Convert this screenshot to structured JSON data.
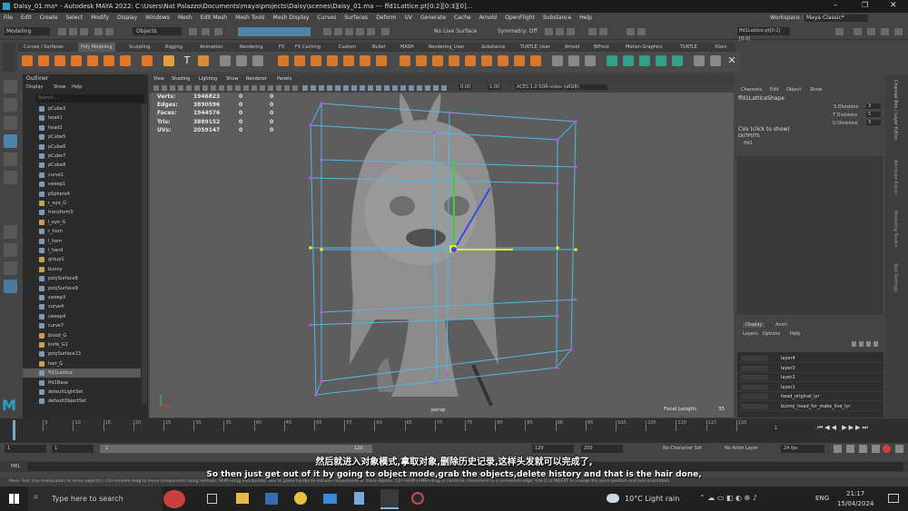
{
  "window": {
    "title": "Daisy_01.ma* - Autodesk MAYA 2022: C:\\Users\\Nat Palazzo\\Documents\\maya\\projects\\Daisy\\scenes\\Daisy_01.ma    ---    ffd1Lattice.pt[0:2][0:3][0]...",
    "workspace_label": "Workspace :",
    "workspace_value": "Maya Classic*"
  },
  "menu": [
    "File",
    "Edit",
    "Create",
    "Select",
    "Modify",
    "Display",
    "Windows",
    "Mesh",
    "Edit Mesh",
    "Mesh Tools",
    "Mesh Display",
    "Curves",
    "Surfaces",
    "Deform",
    "UV",
    "Generate",
    "Cache",
    "Arnold",
    "OpenFlight",
    "Substance",
    "Help"
  ],
  "toolbar": {
    "mode": "Modeling",
    "objects": "Objects",
    "live_surface": "No Live Surface",
    "symmetry": "Symmetry: Off",
    "selection_field": "ffd1Lattice.pt[0:2][0:3]"
  },
  "shelf_tabs": [
    "Curves / Surfaces",
    "Poly Modeling",
    "Sculpting",
    "Rigging",
    "Animation",
    "Rendering",
    "FX",
    "FX Caching",
    "Custom",
    "Bullet",
    "MASH",
    "Rendering_User",
    "Substance",
    "TURTLE_User",
    "Arnold",
    "BiFrost",
    "Motion Graphics",
    "TURTLE",
    "XGen"
  ],
  "outliner": {
    "title": "Outliner",
    "menu": [
      "Display",
      "Show",
      "Help"
    ],
    "search": "Search...",
    "items": [
      "pCube3",
      "head1",
      "head2",
      "pCube5",
      "pCube6",
      "pCube7",
      "pCube8",
      "curve1",
      "sweep1",
      "pSphere4",
      "r_eye_G",
      "transform5",
      "l_eye_G",
      "r_horn",
      "l_horn",
      "l_hand",
      "group1",
      "bunny",
      "polySurface8",
      "polySurface9",
      "sweep3",
      "curve4",
      "sweep4",
      "curve7",
      "blood_G",
      "knife_G1",
      "polySurface13",
      "hair_G",
      "ffd1Lattice",
      "ffd1Base",
      "defaultLightSet",
      "defaultObjectSet"
    ]
  },
  "viewport": {
    "menu": [
      "View",
      "Shading",
      "Lighting",
      "Show",
      "Renderer",
      "Panels"
    ],
    "exposure": "0.00",
    "gamma": "1.00",
    "color_space": "ACES 1.0 SDR-video (sRGB)",
    "camera": "persp",
    "focal_label": "Focal Length:",
    "focal_value": "35",
    "stats": [
      {
        "label": "Verts:",
        "a": "1946823",
        "b": "0",
        "c": "0"
      },
      {
        "label": "Edges:",
        "a": "3890596",
        "b": "0",
        "c": "0"
      },
      {
        "label": "Faces:",
        "a": "1944576",
        "b": "0",
        "c": "0"
      },
      {
        "label": "Tris:",
        "a": "3889152",
        "b": "0",
        "c": "0"
      },
      {
        "label": "UVs:",
        "a": "2059147",
        "b": "0",
        "c": "0"
      }
    ]
  },
  "channel_box": {
    "menu": [
      "Channels",
      "Edit",
      "Object",
      "Show"
    ],
    "node": "ffd1LatticeShape",
    "attrs": [
      {
        "label": "S Divisions",
        "value": "3"
      },
      {
        "label": "T Divisions",
        "value": "5"
      },
      {
        "label": "U Divisions",
        "value": "3"
      }
    ],
    "cvs": "CVs (click to show)",
    "outputs": "OUTPUTS",
    "output_node": "ffd1"
  },
  "layers": {
    "tabs": [
      "Display",
      "Anim"
    ],
    "menu": [
      "Layers",
      "Options",
      "Help"
    ],
    "items": [
      "layer4",
      "layer3",
      "layer2",
      "layer1",
      "head_original_lyr",
      "bunny_head_for_make_live_lyr"
    ]
  },
  "side_tabs": [
    "Channel Box / Layer Editor",
    "Attribute Editor",
    "Modeling Toolkit",
    "Tool Settings"
  ],
  "timeline": {
    "ticks": [
      "5",
      "10",
      "15",
      "20",
      "25",
      "30",
      "35",
      "40",
      "45",
      "50",
      "55",
      "60",
      "65",
      "70",
      "75",
      "80",
      "85",
      "90",
      "95",
      "100",
      "105",
      "110",
      "115",
      "120"
    ],
    "current": "1"
  },
  "range": {
    "start": "1",
    "start2": "1",
    "mid": "120",
    "end2": "120",
    "end": "200",
    "character": "No Character Set",
    "anim_layer": "No Anim Layer",
    "fps": "24 fps"
  },
  "mel_label": "MEL",
  "help_line": "Move Tool: Use manipulator to move object(s). Ctrl+middle-drag to move components along normals. Shift+drag manipulator axis or plane handle to extrude components or clone objects. Ctrl+Shift+LMB+drag to constrain movement to a connected edge. Use D or INSERT to change the pivot position and axis orientation.",
  "subtitle_cn": "然后就进入对象模式,拿取对象,删除历史记录,这样头发就可以完成了,",
  "subtitle_en": "So then just get out of it by going to object mode,grab the objects,delete history and that is the hair done,",
  "taskbar": {
    "search": "Type here to search",
    "weather": "10°C  Light rain",
    "lang": "ENG",
    "time": "21:17",
    "date": "15/04/2024"
  }
}
